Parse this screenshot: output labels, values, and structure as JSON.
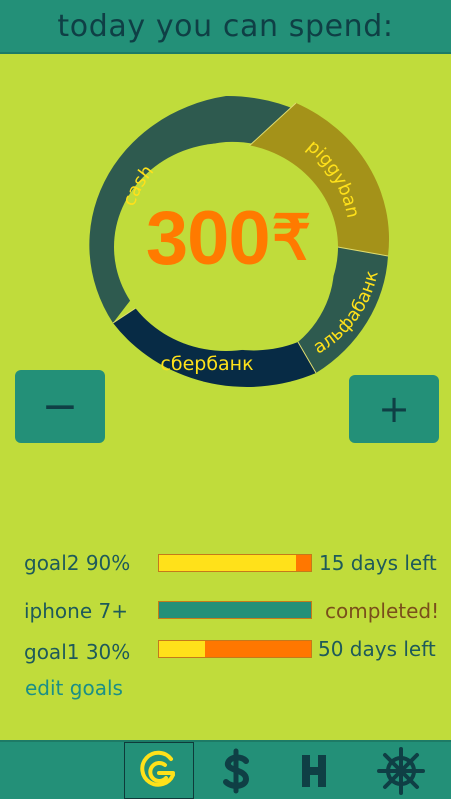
{
  "header": {
    "title": "today you can spend:"
  },
  "wallet": {
    "amount": "300",
    "currency_symbol": "₹",
    "segments": [
      {
        "label": "cash",
        "color": "#2e5a4f",
        "text_color": "#ffe11a"
      },
      {
        "label": "piggybank",
        "color": "#a49219",
        "text_color": "#ffe11a"
      },
      {
        "label": "альфабанк",
        "color": "#2e5a4f",
        "text_color": "#ffe11a"
      },
      {
        "label": "сбербанк",
        "color": "#072b45",
        "text_color": "#ffe11a"
      }
    ]
  },
  "controls": {
    "minus": "−",
    "plus": "+"
  },
  "goals": [
    {
      "name": "goal2 90%",
      "status": "15 days left",
      "progress": 0.9,
      "complete": false
    },
    {
      "name": "iphone 7+",
      "status": "completed!",
      "progress": 1.0,
      "complete": true
    },
    {
      "name": "goal1 30%",
      "status": "50 days left",
      "progress": 0.3,
      "complete": false
    }
  ],
  "edit_goals_label": "edit goals",
  "tabs": [
    {
      "name": "goals",
      "icon": "goals-icon"
    },
    {
      "name": "money",
      "icon": "dollar-icon"
    },
    {
      "name": "home",
      "icon": "h-icon"
    },
    {
      "name": "settings",
      "icon": "helm-icon"
    }
  ],
  "colors": {
    "background": "#c0dc3b",
    "primary": "#239078",
    "amount": "#ff7a00",
    "progress_fill": "#ffe11a",
    "progress_track": "#ff7700"
  }
}
